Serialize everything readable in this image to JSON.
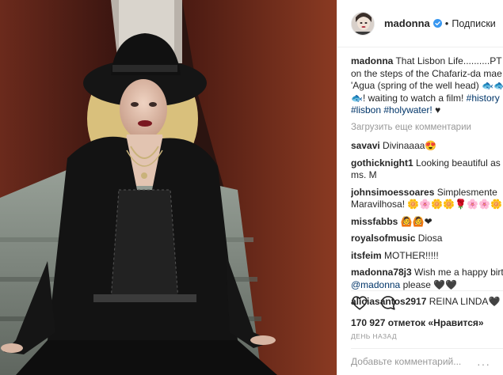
{
  "post": {
    "username": "madonna",
    "follow_label": "Подписки",
    "separator": "•",
    "likes_text": "170 927 отметок «Нравится»",
    "time_text": "ДЕНЬ НАЗАД",
    "comment_placeholder": "Добавьте комментарий...",
    "more_label": "···"
  },
  "caption": {
    "user": "madonna",
    "text_1": "That Lisbon Life..........PT Sittin",
    "text_2": "on the steps of the Chafariz-da mae d",
    "text_3": "'Agua (spring of the well head) 🐟🐟🐟",
    "text_4": "🐟! waiting to watch a film!",
    "tag_1": "#history",
    "tag_2": "#lisbon",
    "tag_3": "#holywater!",
    "text_5": "♥"
  },
  "load_more_label": "Загрузить еще комментарии",
  "comments": [
    {
      "user": "savavi",
      "text": "Divinaaaa😍"
    },
    {
      "user": "gothicknight1",
      "text": "Looking beautiful as ever",
      "text_2": "ms. M"
    },
    {
      "user": "johnsimoessoares",
      "text": "Simplesmente",
      "text_2": "Maravilhosa! 🌼🌸🌼🌼🌹🌸🌸🌼"
    },
    {
      "user": "missfabbs",
      "text": "🙆🙆❤"
    },
    {
      "user": "royalsofmusic",
      "text": "Diosa"
    },
    {
      "user": "itsfeim",
      "text": "MOTHER!!!!!"
    },
    {
      "user": "madonna78j3",
      "text": "Wish me a happy birthd",
      "mention": "@madonna",
      "text_2": "please 🖤🖤"
    },
    {
      "user": "aliciasantos2917",
      "text": "REINA LINDA🖤"
    }
  ],
  "icons": {
    "like": "heart-icon",
    "comment": "comment-bubble-icon",
    "verified": "verified-badge-icon",
    "more": "ellipsis-icon"
  },
  "colors": {
    "link": "#003569",
    "verified": "#3897f0",
    "muted": "#999999",
    "text": "#262626"
  }
}
